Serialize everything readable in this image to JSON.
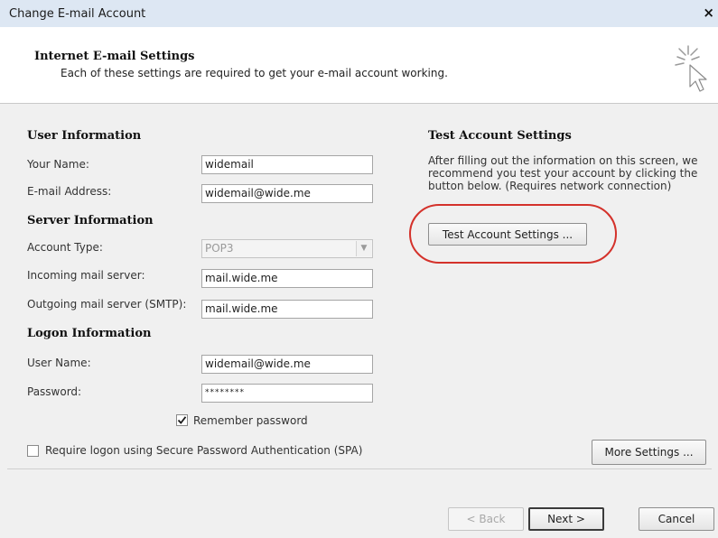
{
  "window": {
    "title": "Change E-mail Account",
    "close_glyph": "×"
  },
  "header": {
    "title": "Internet E-mail Settings",
    "subtitle": "Each of these settings are required to get your e-mail account working.",
    "icon": "wizard-cursor-icon"
  },
  "user_info": {
    "heading": "User Information",
    "name_label": "Your Name:",
    "name_value": "widemail",
    "email_label": "E-mail Address:",
    "email_value": "widemail@wide.me"
  },
  "server_info": {
    "heading": "Server Information",
    "account_type_label": "Account Type:",
    "account_type_value": "POP3",
    "incoming_label": "Incoming mail server:",
    "incoming_value": "mail.wide.me",
    "outgoing_label": "Outgoing mail server (SMTP):",
    "outgoing_value": "mail.wide.me"
  },
  "logon_info": {
    "heading": "Logon Information",
    "username_label": "User Name:",
    "username_value": "widemail@wide.me",
    "password_label": "Password:",
    "password_value": "********",
    "remember_label": "Remember password",
    "remember_checked": true,
    "spa_label": "Require logon using Secure Password Authentication (SPA)",
    "spa_checked": false
  },
  "test_settings": {
    "heading": "Test Account Settings",
    "description": "After filling out the information on this screen, we recommend you test your account by clicking the button below. (Requires network connection)",
    "button_label": "Test Account Settings ...",
    "highlight_color": "#d4322b"
  },
  "buttons": {
    "more_settings": "More Settings ...",
    "back": "< Back",
    "next": "Next >",
    "cancel": "Cancel"
  },
  "colors": {
    "titlebar": "#dde7f3",
    "dialog_bg": "#f0f0f0",
    "header_bg": "#ffffff"
  }
}
